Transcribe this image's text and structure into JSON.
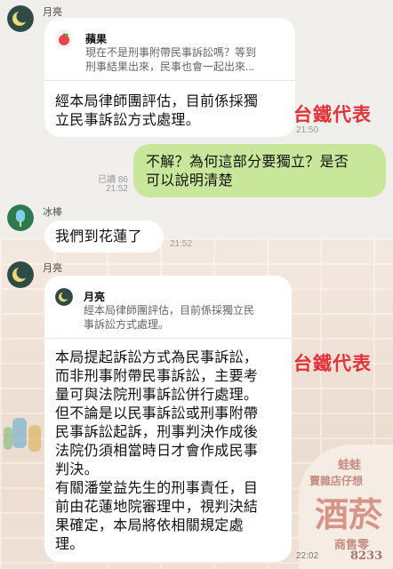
{
  "messages": {
    "m1": {
      "sender": "月亮",
      "quote_name": "蘋果",
      "quote_text_1": "現在不是刑事附帶民事訴訟嗎？等到",
      "quote_text_2": "刑事結果出來，民事也會一起出來...",
      "text_1": "經本局律師團評估，目前係採獨",
      "text_2": "立民事訴訟方式處理。",
      "time": "21:50"
    },
    "m2": {
      "text_1": "不解？為何這部分要獨立？是否",
      "text_2": "可以說明清楚",
      "read": "已讀 86",
      "time": "21:52"
    },
    "m3": {
      "sender": "冰棒",
      "text": "我們到花蓮了",
      "time": "21:52"
    },
    "m4": {
      "sender": "月亮",
      "quote_name": "月亮",
      "quote_text_1": "經本局律師團評估，目前係採獨立民",
      "quote_text_2": "事訴訟方式處理。",
      "lines": [
        "本局提起訴訟方式為民事訴訟，",
        "而非刑事附帶民事訴訟，主要考",
        "量可與法院刑事訴訟併行處理。",
        "但不論是以民事訴訟或刑事附帶",
        "民事訴訟起訴，刑事判決作成後",
        "法院仍須相當時日才會作成民事",
        "判決。",
        "有關潘堂益先生的刑事責任，目",
        "前由花蓮地院審理中，視判決結",
        "果確定，本局將依相關規定處",
        "理。"
      ],
      "time": "22:02"
    }
  },
  "overlays": {
    "label_1": "台鐵代表",
    "label_2": "台鐵代表"
  },
  "background_sign": {
    "top": "蛙蛙",
    "line2": "賣雜店仔想",
    "big": "酒菸",
    "line4": "商售零",
    "phone": "8233"
  },
  "colors": {
    "outgoing_bubble": "#c9e79a",
    "incoming_bubble": "#ffffff",
    "overlay_red": "#e0333a"
  }
}
